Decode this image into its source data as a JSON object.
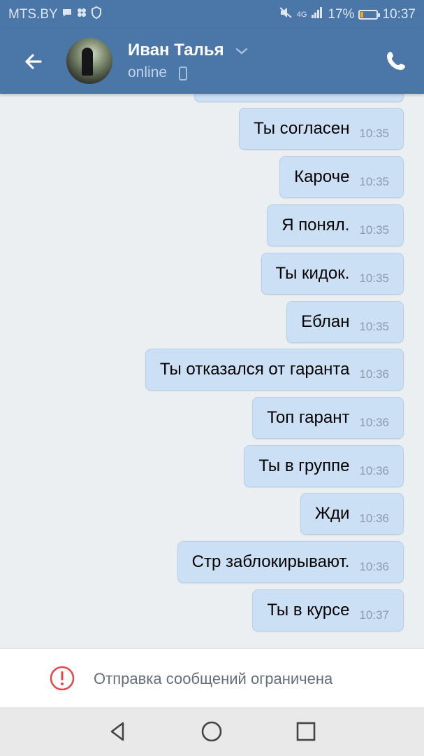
{
  "status_bar": {
    "carrier": "MTS.BY",
    "network": "4G",
    "battery_percent": "17%",
    "battery_level": 0.17,
    "time": "10:37",
    "icons": [
      "message-icon",
      "apps-icon",
      "shield-icon",
      "mute-icon",
      "signal-icon",
      "battery-icon"
    ]
  },
  "header": {
    "contact_name": "Иван Талья",
    "status": "online",
    "icons": [
      "back-arrow-icon",
      "chevron-down-icon",
      "mobile-device-icon",
      "phone-icon"
    ]
  },
  "messages": [
    {
      "text": "Ты согласен",
      "time": "10:35"
    },
    {
      "text": "Кароче",
      "time": "10:35"
    },
    {
      "text": "Я понял.",
      "time": "10:35"
    },
    {
      "text": "Ты кидок.",
      "time": "10:35"
    },
    {
      "text": "Еблан",
      "time": "10:35"
    },
    {
      "text": "Ты отказался от гаранта",
      "time": "10:36"
    },
    {
      "text": "Топ гарант",
      "time": "10:36"
    },
    {
      "text": "Ты в группе",
      "time": "10:36"
    },
    {
      "text": "Жди",
      "time": "10:36"
    },
    {
      "text": "Стр заблокирывают.",
      "time": "10:36"
    },
    {
      "text": "Ты в курсе",
      "time": "10:37"
    }
  ],
  "restriction": {
    "text": "Отправка сообщений ограничена",
    "icon": "warning-icon",
    "accent_color": "#e64646"
  },
  "nav_bar": {
    "icons": [
      "nav-back-icon",
      "nav-home-icon",
      "nav-recents-icon"
    ]
  },
  "colors": {
    "header_bg": "#4a76a8",
    "bubble_bg": "#cce0f5",
    "chat_bg": "#eceff2"
  }
}
